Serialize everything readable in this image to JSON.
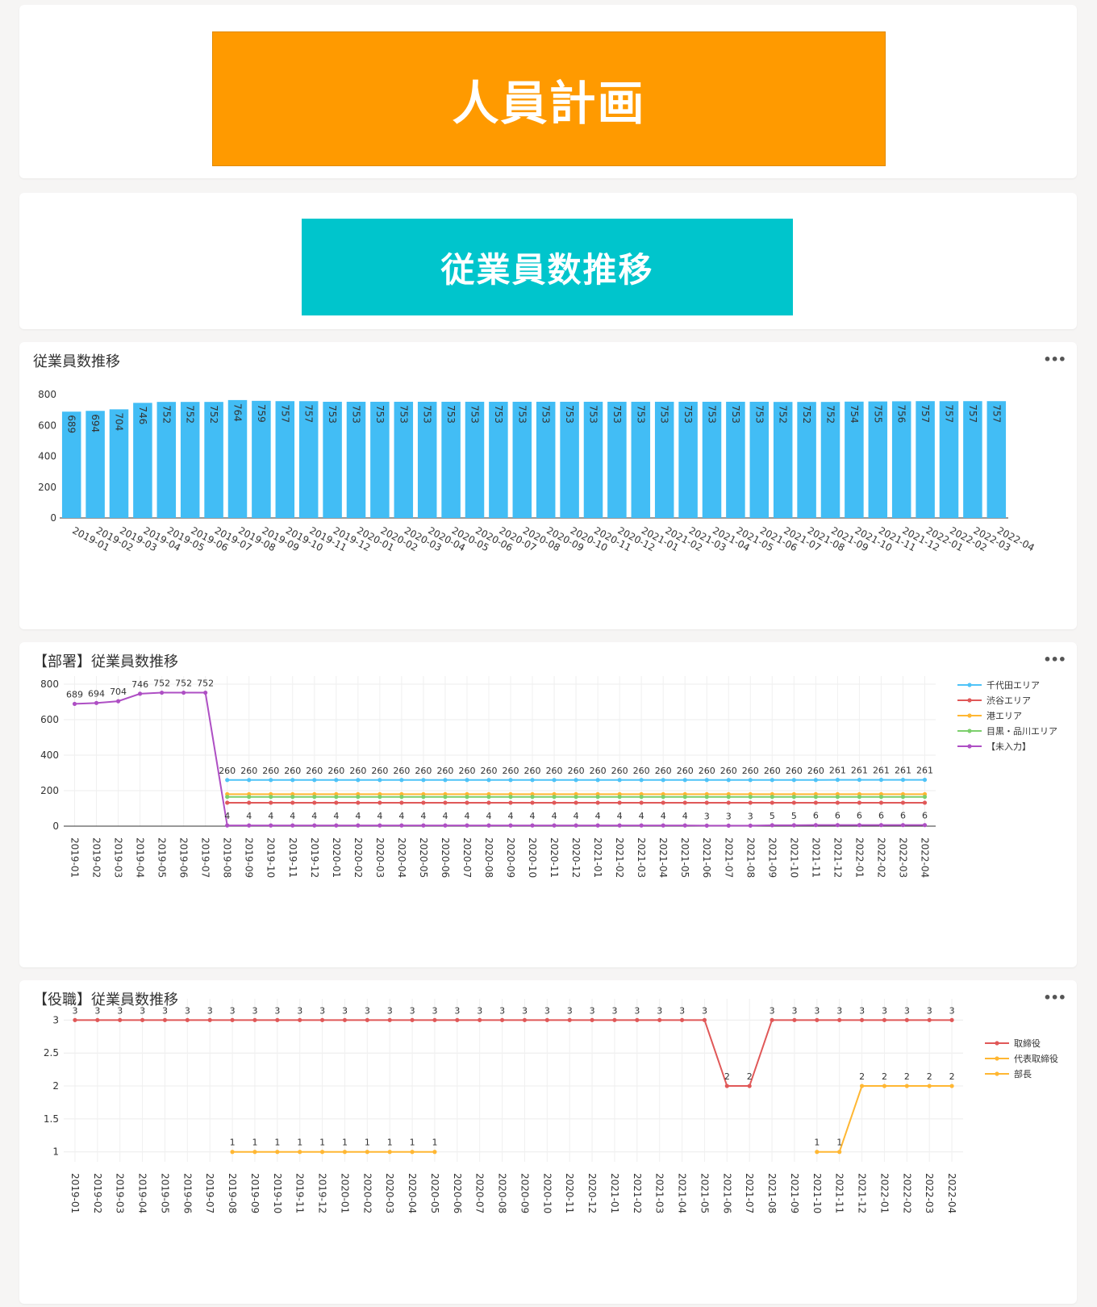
{
  "title_banner": {
    "text": "人員計画",
    "color": "#ff9a00"
  },
  "subtitle_banner": {
    "text": "従業員数推移",
    "color": "#00c5cc"
  },
  "menu_icon": "more-dots-icon",
  "chart_data": [
    {
      "type": "bar",
      "title": "従業員数推移",
      "categories": [
        "2019-01",
        "2019-02",
        "2019-03",
        "2019-04",
        "2019-05",
        "2019-06",
        "2019-07",
        "2019-08",
        "2019-09",
        "2019-10",
        "2019-11",
        "2019-12",
        "2020-01",
        "2020-02",
        "2020-03",
        "2020-04",
        "2020-05",
        "2020-06",
        "2020-07",
        "2020-08",
        "2020-09",
        "2020-10",
        "2020-11",
        "2020-12",
        "2021-01",
        "2021-02",
        "2021-03",
        "2021-04",
        "2021-05",
        "2021-06",
        "2021-07",
        "2021-08",
        "2021-09",
        "2021-10",
        "2021-11",
        "2021-12",
        "2022-01",
        "2022-02",
        "2022-03",
        "2022-04"
      ],
      "values": [
        689,
        694,
        704,
        746,
        752,
        752,
        752,
        764,
        759,
        757,
        757,
        753,
        753,
        753,
        753,
        753,
        753,
        753,
        753,
        753,
        753,
        753,
        753,
        753,
        753,
        753,
        753,
        753,
        753,
        753,
        752,
        752,
        752,
        754,
        755,
        756,
        757,
        757,
        757,
        757
      ],
      "ylim": [
        0,
        800
      ],
      "yticks": [
        0,
        200,
        400,
        600,
        800
      ],
      "color": "#42bdf5"
    },
    {
      "type": "line",
      "title": "【部署】従業員数推移",
      "categories": [
        "2019-01",
        "2019-02",
        "2019-03",
        "2019-04",
        "2019-05",
        "2019-06",
        "2019-07",
        "2019-08",
        "2019-09",
        "2019-10",
        "2019-11",
        "2019-12",
        "2020-01",
        "2020-02",
        "2020-03",
        "2020-04",
        "2020-05",
        "2020-06",
        "2020-07",
        "2020-08",
        "2020-09",
        "2020-10",
        "2020-11",
        "2020-12",
        "2021-01",
        "2021-02",
        "2021-03",
        "2021-04",
        "2021-05",
        "2021-06",
        "2021-07",
        "2021-08",
        "2021-09",
        "2021-10",
        "2021-11",
        "2021-12",
        "2022-01",
        "2022-02",
        "2022-03",
        "2022-04"
      ],
      "ylim": [
        0,
        800
      ],
      "yticks": [
        0,
        200,
        400,
        600,
        800
      ],
      "grid": true,
      "legend": "right",
      "series": [
        {
          "name": "千代田エリア",
          "color": "#4fc3f7",
          "labels": true,
          "values": [
            null,
            null,
            null,
            null,
            null,
            null,
            null,
            260,
            260,
            260,
            260,
            260,
            260,
            260,
            260,
            260,
            260,
            260,
            260,
            260,
            260,
            260,
            260,
            260,
            260,
            260,
            260,
            260,
            260,
            260,
            260,
            260,
            260,
            260,
            260,
            261,
            261,
            261,
            261,
            261
          ]
        },
        {
          "name": "渋谷エリア",
          "color": "#e05858",
          "labels": false,
          "values": [
            null,
            null,
            null,
            null,
            null,
            null,
            null,
            132,
            132,
            132,
            132,
            132,
            132,
            132,
            132,
            132,
            132,
            132,
            132,
            132,
            132,
            132,
            132,
            132,
            132,
            132,
            132,
            132,
            132,
            132,
            132,
            132,
            132,
            132,
            132,
            132,
            132,
            132,
            132,
            132
          ]
        },
        {
          "name": "港エリア",
          "color": "#ffb733",
          "labels": false,
          "values": [
            null,
            null,
            null,
            null,
            null,
            null,
            null,
            180,
            180,
            180,
            180,
            180,
            180,
            180,
            180,
            180,
            180,
            180,
            180,
            180,
            180,
            180,
            180,
            180,
            180,
            180,
            180,
            180,
            180,
            180,
            180,
            180,
            180,
            180,
            180,
            180,
            180,
            180,
            180,
            180
          ]
        },
        {
          "name": "目黒・品川エリア",
          "color": "#7ccf6c",
          "labels": false,
          "values": [
            null,
            null,
            null,
            null,
            null,
            null,
            null,
            165,
            165,
            165,
            165,
            165,
            165,
            165,
            165,
            165,
            165,
            165,
            165,
            165,
            165,
            165,
            165,
            165,
            165,
            165,
            165,
            165,
            165,
            165,
            165,
            165,
            165,
            165,
            165,
            165,
            165,
            165,
            165,
            165
          ]
        },
        {
          "name": "【未入力】",
          "color": "#ae4fc4",
          "labels": true,
          "values": [
            689,
            694,
            704,
            746,
            752,
            752,
            752,
            4,
            4,
            4,
            4,
            4,
            4,
            4,
            4,
            4,
            4,
            4,
            4,
            4,
            4,
            4,
            4,
            4,
            4,
            4,
            4,
            4,
            4,
            3,
            3,
            3,
            5,
            5,
            6,
            6,
            6,
            6,
            6,
            6
          ]
        }
      ]
    },
    {
      "type": "line",
      "title": "【役職】従業員数推移",
      "categories": [
        "2019-01",
        "2019-02",
        "2019-03",
        "2019-04",
        "2019-05",
        "2019-06",
        "2019-07",
        "2019-08",
        "2019-09",
        "2019-10",
        "2019-11",
        "2019-12",
        "2020-01",
        "2020-02",
        "2020-03",
        "2020-04",
        "2020-05",
        "2020-06",
        "2020-07",
        "2020-08",
        "2020-09",
        "2020-10",
        "2020-11",
        "2020-12",
        "2021-01",
        "2021-02",
        "2021-03",
        "2021-04",
        "2021-05",
        "2021-06",
        "2021-07",
        "2021-08",
        "2021-09",
        "2021-10",
        "2021-11",
        "2021-12",
        "2022-01",
        "2022-02",
        "2022-03",
        "2022-04"
      ],
      "ylim": [
        0.85,
        3.2
      ],
      "yticks": [
        1,
        1.5,
        2,
        2.5,
        3
      ],
      "grid": true,
      "legend": "right",
      "series": [
        {
          "name": "取締役",
          "color": "#e05858",
          "labels": true,
          "values": [
            3,
            3,
            3,
            3,
            3,
            3,
            3,
            3,
            3,
            3,
            3,
            3,
            3,
            3,
            3,
            3,
            3,
            3,
            3,
            3,
            3,
            3,
            3,
            3,
            3,
            3,
            3,
            3,
            3,
            2,
            2,
            3,
            3,
            3,
            3,
            3,
            3,
            3,
            3,
            3
          ]
        },
        {
          "name": "代表取締役",
          "color": "#ffb733",
          "labels": true,
          "values": [
            null,
            null,
            null,
            null,
            null,
            null,
            null,
            1,
            1,
            1,
            1,
            1,
            1,
            1,
            1,
            1,
            1,
            null,
            null,
            null,
            null,
            null,
            null,
            null,
            null,
            null,
            null,
            null,
            null,
            null,
            null,
            null,
            null,
            null,
            null,
            null,
            null,
            null,
            null,
            null
          ]
        },
        {
          "name": "部長",
          "color": "#ffb733",
          "labels": true,
          "values": [
            null,
            null,
            null,
            null,
            null,
            null,
            null,
            null,
            null,
            null,
            null,
            null,
            null,
            null,
            null,
            null,
            null,
            null,
            null,
            null,
            null,
            null,
            null,
            null,
            null,
            null,
            null,
            null,
            null,
            null,
            null,
            null,
            null,
            1,
            1,
            2,
            2,
            2,
            2,
            2
          ]
        }
      ]
    }
  ]
}
